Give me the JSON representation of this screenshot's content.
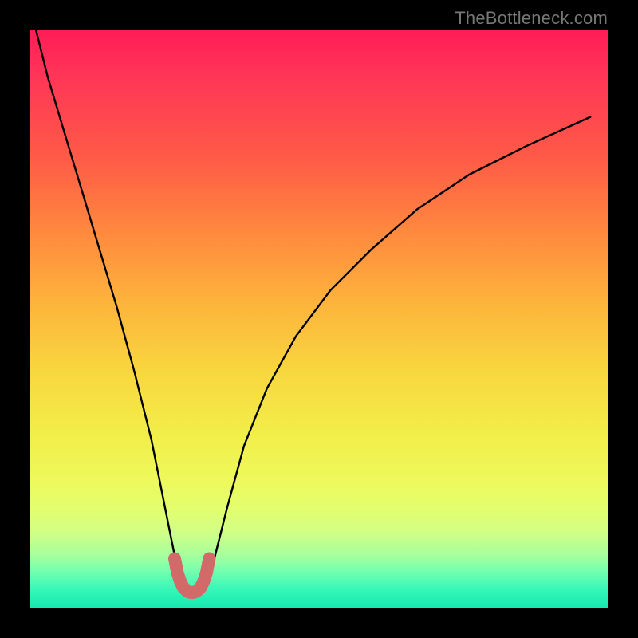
{
  "attribution": "TheBottleneck.com",
  "chart_data": {
    "type": "line",
    "title": "",
    "xlabel": "",
    "ylabel": "",
    "xlim": [
      0,
      100
    ],
    "ylim": [
      0,
      100
    ],
    "series": [
      {
        "name": "bottleneck-curve",
        "x": [
          1,
          3,
          6,
          9,
          12,
          15,
          18,
          21,
          23,
          25,
          26,
          27,
          28,
          29,
          30,
          31,
          32,
          34,
          37,
          41,
          46,
          52,
          59,
          67,
          76,
          86,
          97
        ],
        "values": [
          100,
          92,
          82,
          72,
          62,
          52,
          41,
          29,
          19,
          9,
          5,
          3,
          2,
          2,
          3,
          5,
          9,
          17,
          28,
          38,
          47,
          55,
          62,
          69,
          75,
          80,
          85
        ]
      },
      {
        "name": "highlight-segment",
        "x": [
          25.0,
          25.5,
          26.0,
          26.5,
          27.0,
          27.5,
          28.0,
          28.5,
          29.0,
          29.5,
          30.0,
          30.5,
          31.0
        ],
        "values": [
          8.5,
          6.0,
          4.5,
          3.5,
          3.0,
          2.7,
          2.6,
          2.7,
          3.0,
          3.5,
          4.5,
          6.0,
          8.5
        ]
      }
    ],
    "colors": {
      "curve": "#000000",
      "highlight": "#d36a6a",
      "gradient_top": "#ff1c55",
      "gradient_bottom": "#17e9ae"
    }
  }
}
